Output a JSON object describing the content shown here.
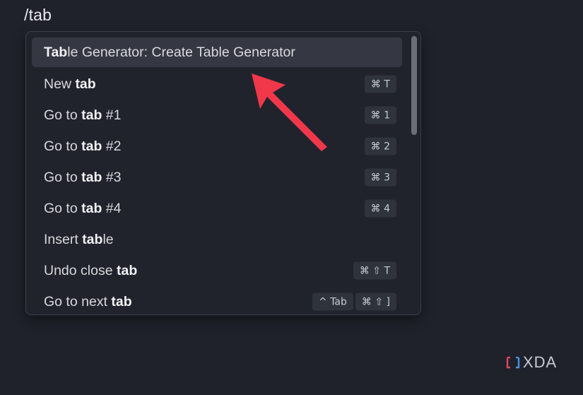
{
  "query": "/tab",
  "palette": {
    "items": [
      {
        "pre": "",
        "bold": "Tab",
        "post": "le Generator: Create Table Generator",
        "keys": [],
        "selected": true
      },
      {
        "pre": "New ",
        "bold": "tab",
        "post": "",
        "keys": [
          "⌘ T"
        ],
        "selected": false
      },
      {
        "pre": "Go to ",
        "bold": "tab",
        "post": " #1",
        "keys": [
          "⌘ 1"
        ],
        "selected": false
      },
      {
        "pre": "Go to ",
        "bold": "tab",
        "post": " #2",
        "keys": [
          "⌘ 2"
        ],
        "selected": false
      },
      {
        "pre": "Go to ",
        "bold": "tab",
        "post": " #3",
        "keys": [
          "⌘ 3"
        ],
        "selected": false
      },
      {
        "pre": "Go to ",
        "bold": "tab",
        "post": " #4",
        "keys": [
          "⌘ 4"
        ],
        "selected": false
      },
      {
        "pre": "Insert ",
        "bold": "tab",
        "post": "le",
        "keys": [],
        "selected": false
      },
      {
        "pre": "Undo close ",
        "bold": "tab",
        "post": "",
        "keys": [
          "⌘ ⇧ T"
        ],
        "selected": false
      },
      {
        "pre": "Go to next ",
        "bold": "tab",
        "post": "",
        "keys": [
          "^ Tab",
          "⌘ ⇧ ]"
        ],
        "selected": false
      }
    ]
  },
  "watermark": {
    "text": "XDA"
  },
  "colors": {
    "background": "#1f222b",
    "selected_row": "#353842",
    "arrow": "#f0384a"
  }
}
